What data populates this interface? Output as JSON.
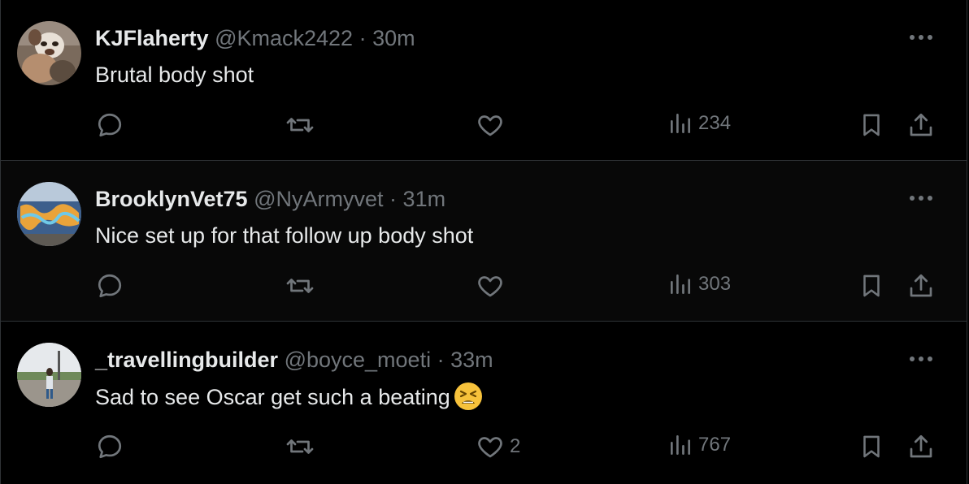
{
  "replies": [
    {
      "name": "KJFlaherty",
      "handle": "@Kmack2422",
      "separator": "·",
      "time": "30m",
      "text": "Brutal body shot",
      "likes": "",
      "views": "234",
      "avatar_icon": "dog-photo-avatar"
    },
    {
      "name": "BrooklynVet75",
      "handle": "@NyArmyvet",
      "separator": "·",
      "time": "31m",
      "text": "Nice set up for that follow up body shot",
      "likes": "",
      "views": "303",
      "avatar_icon": "graffiti-wall-avatar"
    },
    {
      "name": "_travellingbuilder",
      "handle": "@boyce_moeti",
      "separator": "·",
      "time": "33m",
      "text": "Sad to see Oscar get such a beating",
      "likes": "2",
      "views": "767",
      "avatar_icon": "person-street-avatar",
      "emoji": "tired-face-emoji"
    }
  ],
  "colors": {
    "background": "#000000",
    "text": "#e7e9ea",
    "muted": "#71767b",
    "border": "#2f3336",
    "emoji_yellow": "#f7c23b"
  }
}
